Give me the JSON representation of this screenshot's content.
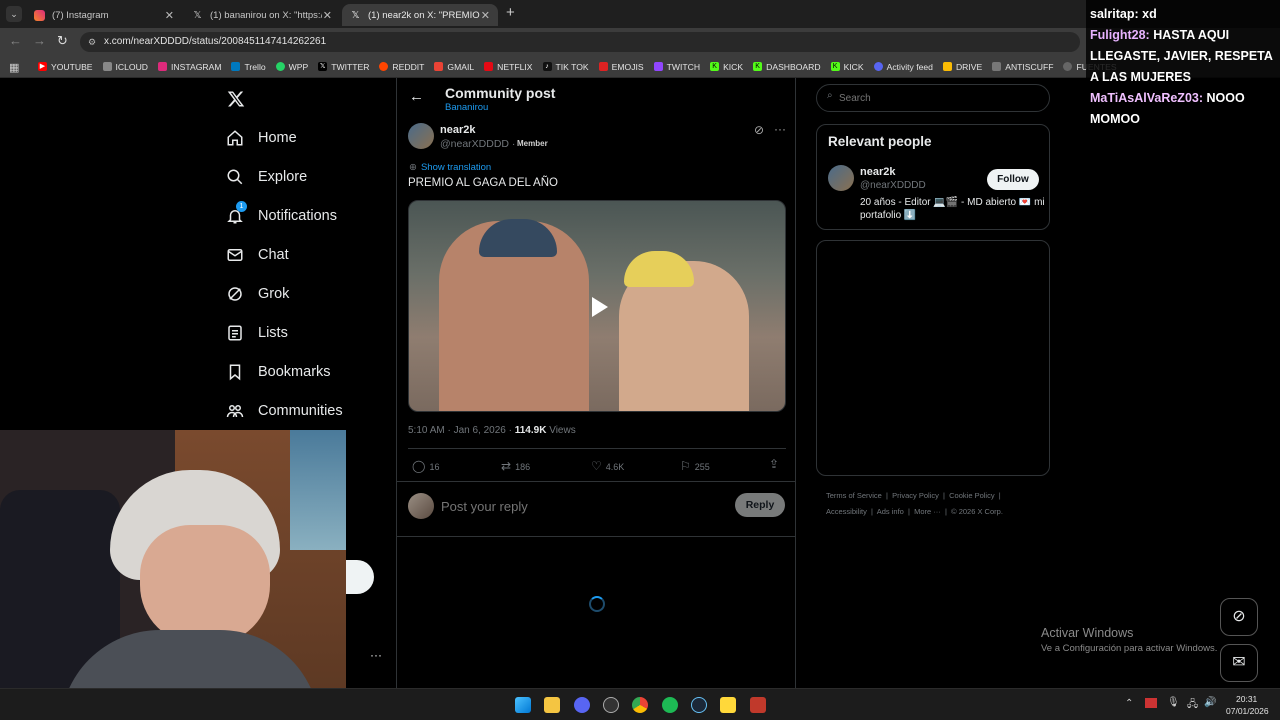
{
  "browser": {
    "tabs": [
      {
        "label": "(7) Instagram",
        "icon": "instagram-icon"
      },
      {
        "label": "(1) bananirou on X: \"https://t.co",
        "icon": "x-icon"
      },
      {
        "label": "(1) near2k on X: \"PREMIO AL GA",
        "icon": "x-icon"
      }
    ],
    "new_tab": "+",
    "url": "x.com/nearXDDDD/status/2008451147414262261",
    "bookmarks": [
      "YOUTUBE",
      "ICLOUD",
      "INSTAGRAM",
      "Trello",
      "WPP",
      "TWITTER",
      "REDDIT",
      "GMAIL",
      "NETFLIX",
      "TIK TOK",
      "EMOJIS",
      "TWITCH",
      "KICK",
      "DASHBOARD",
      "KICK",
      "Activity feed",
      "DRIVE",
      "ANTISCUFF",
      "FUENTES"
    ]
  },
  "sidebar": {
    "items": [
      {
        "label": "Home",
        "icon": "home-icon"
      },
      {
        "label": "Explore",
        "icon": "search-icon"
      },
      {
        "label": "Notifications",
        "icon": "bell-icon",
        "badge": "1"
      },
      {
        "label": "Chat",
        "icon": "mail-icon"
      },
      {
        "label": "Grok",
        "icon": "grok-icon"
      },
      {
        "label": "Lists",
        "icon": "list-icon"
      },
      {
        "label": "Bookmarks",
        "icon": "bookmark-icon"
      },
      {
        "label": "Communities",
        "icon": "communities-icon"
      }
    ],
    "more": "···"
  },
  "post": {
    "header_title": "Community post",
    "header_sub": "Bananirou",
    "author_name": "near2k",
    "author_handle": "@nearXDDDD ·",
    "member_badge": "Member",
    "translate": "Show translation",
    "text": "PREMIO AL GAGA DEL AÑO",
    "timestamp": "5:10 AM · Jan 6, 2026 · ",
    "views_count": "114.9K",
    "views_label": " Views",
    "replies": "16",
    "reposts": "186",
    "likes": "4.6K",
    "bookmarks": "255",
    "reply_placeholder": "Post your reply",
    "reply_button": "Reply"
  },
  "right": {
    "search_placeholder": "Search",
    "relevant_title": "Relevant people",
    "person_name": "near2k",
    "person_handle": "@nearXDDDD",
    "follow": "Follow",
    "bio": "20 años - Editor 💻🎬 - MD abierto 💌 mi portafolio ⬇️",
    "footer": [
      "Terms of Service",
      "Privacy Policy",
      "Cookie Policy",
      "Accessibility",
      "Ads info",
      "More ···",
      "© 2026 X Corp."
    ]
  },
  "chat": {
    "messages": [
      {
        "user": "salritap:",
        "text": " xd",
        "color": "#ffffff"
      },
      {
        "user": "Fulight28:",
        "text": " HASTA AQUI LLEGASTE, JAVIER, RESPETA A LAS MUJERES",
        "color": "#e8b3ff"
      },
      {
        "user": "MaTiAsAlVaReZ03:",
        "text": " NOOO MOMOO",
        "color": "#f0c0ff"
      }
    ]
  },
  "windows": {
    "activate_title": "Activar Windows",
    "activate_sub": "Ve a Configuración para activar Windows.",
    "time": "20:31",
    "date": "07/01/2026"
  },
  "colors": {
    "x_blue": "#1d9bf0",
    "border": "#2f3336",
    "muted": "#71767b"
  }
}
